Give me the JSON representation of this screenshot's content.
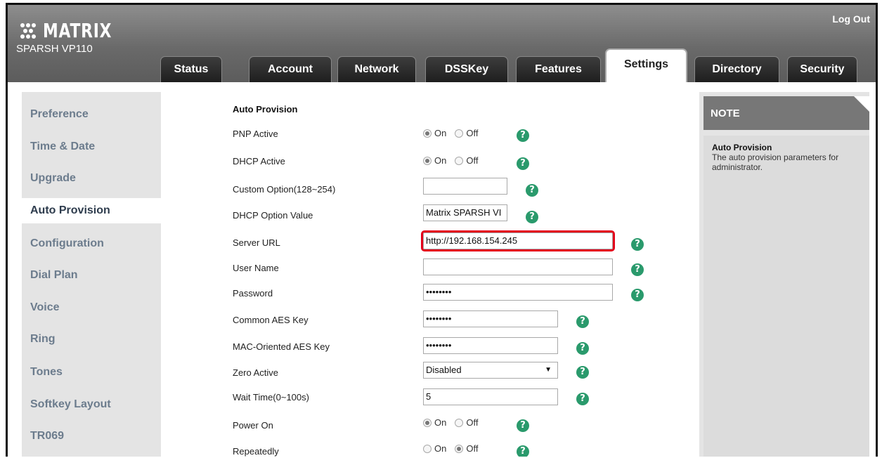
{
  "header": {
    "brand": "MATRIX",
    "model": "SPARSH VP110",
    "logout_label": "Log Out"
  },
  "tabs": [
    {
      "label": "Status",
      "active": false
    },
    {
      "label": "Account",
      "active": false
    },
    {
      "label": "Network",
      "active": false
    },
    {
      "label": "DSSKey",
      "active": false
    },
    {
      "label": "Features",
      "active": false
    },
    {
      "label": "Settings",
      "active": true
    },
    {
      "label": "Directory",
      "active": false
    },
    {
      "label": "Security",
      "active": false
    }
  ],
  "sidebar": {
    "items": [
      {
        "label": "Preference"
      },
      {
        "label": "Time & Date"
      },
      {
        "label": "Upgrade"
      },
      {
        "label": "Auto Provision",
        "active": true
      },
      {
        "label": "Configuration"
      },
      {
        "label": "Dial Plan"
      },
      {
        "label": "Voice"
      },
      {
        "label": "Ring"
      },
      {
        "label": "Tones"
      },
      {
        "label": "Softkey Layout"
      },
      {
        "label": "TR069"
      }
    ]
  },
  "form": {
    "title": "Auto Provision",
    "radio_on": "On",
    "radio_off": "Off",
    "help_glyph": "?",
    "pnp_active": {
      "label": "PNP Active",
      "value": "On"
    },
    "dhcp_active": {
      "label": "DHCP Active",
      "value": "On"
    },
    "custom_option": {
      "label": "Custom Option(128~254)",
      "value": ""
    },
    "dhcp_option_value": {
      "label": "DHCP Option Value",
      "value": "Matrix SPARSH VI"
    },
    "server_url": {
      "label": "Server URL",
      "value": "http://192.168.154.245"
    },
    "user_name": {
      "label": "User Name",
      "value": ""
    },
    "password": {
      "label": "Password",
      "value": "••••••••"
    },
    "common_aes_key": {
      "label": "Common AES Key",
      "value": "••••••••"
    },
    "mac_aes_key": {
      "label": "MAC-Oriented AES Key",
      "value": "••••••••"
    },
    "zero_active": {
      "label": "Zero Active",
      "value": "Disabled"
    },
    "wait_time": {
      "label": "Wait Time(0~100s)",
      "value": "5"
    },
    "power_on": {
      "label": "Power On",
      "value": "On"
    },
    "repeatedly": {
      "label": "Repeatedly",
      "value": "Off"
    }
  },
  "note": {
    "heading": "NOTE",
    "title": "Auto Provision",
    "text": "The auto provision parameters for administrator."
  },
  "colors": {
    "header_gray": "#6a6a6a",
    "tab_dark": "#1e1e1e",
    "help_green": "#2a9a6c",
    "sidebar_text": "#6c7c8d",
    "highlight_red": "#e3001b"
  },
  "icons": {
    "help": "question-circle-icon",
    "logo": "matrix-logo-icon",
    "dropdown": "caret-down-icon"
  }
}
